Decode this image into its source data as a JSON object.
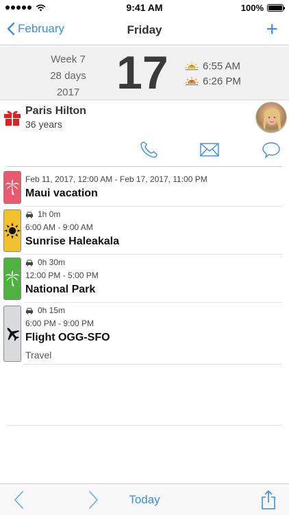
{
  "status_bar": {
    "carrier_icon": "signal-dots-icon",
    "wifi_icon": "wifi-icon",
    "time": "9:41 AM",
    "battery_text": "100%",
    "battery_level": 1.0
  },
  "nav": {
    "back_label": "February",
    "title": "Friday",
    "add_label": "+"
  },
  "date_header": {
    "week": "Week 7",
    "days": "28 days",
    "year": "2017",
    "day_number": "17",
    "sunrise": "6:55 AM",
    "sunset": "6:26 PM"
  },
  "birthday": {
    "name": "Paris Hilton",
    "age": "36 years",
    "gift_color": "#e02020",
    "actions": [
      "phone-icon",
      "mail-icon",
      "message-icon"
    ]
  },
  "events": [
    {
      "color": "#ea5a6e",
      "icon": "palm-tree-icon",
      "time_range": "Feb 11, 2017, 12:00 AM - Feb 17, 2017, 11:00 PM",
      "title": "Maui vacation"
    },
    {
      "color": "#f2c12e",
      "icon": "sun-icon",
      "travel_time": "1h 0m",
      "time_range": "6:00 AM - 9:00 AM",
      "title": "Sunrise Haleakala"
    },
    {
      "color": "#4db23e",
      "icon": "palm-tree-icon",
      "travel_time": "0h 30m",
      "time_range": "12:00 PM - 5:00 PM",
      "title": "National Park"
    },
    {
      "color": "#d8dadc",
      "icon": "airplane-icon",
      "travel_time": "0h 15m",
      "time_range": "6:00 PM - 9:00 PM",
      "title": "Flight OGG-SFO",
      "subtitle": "Travel"
    }
  ],
  "toolbar": {
    "today_label": "Today",
    "prev_icon": "chevron-left-icon",
    "next_icon": "chevron-right-icon",
    "share_icon": "share-icon"
  },
  "colors": {
    "accent": "#3a8ee6"
  }
}
